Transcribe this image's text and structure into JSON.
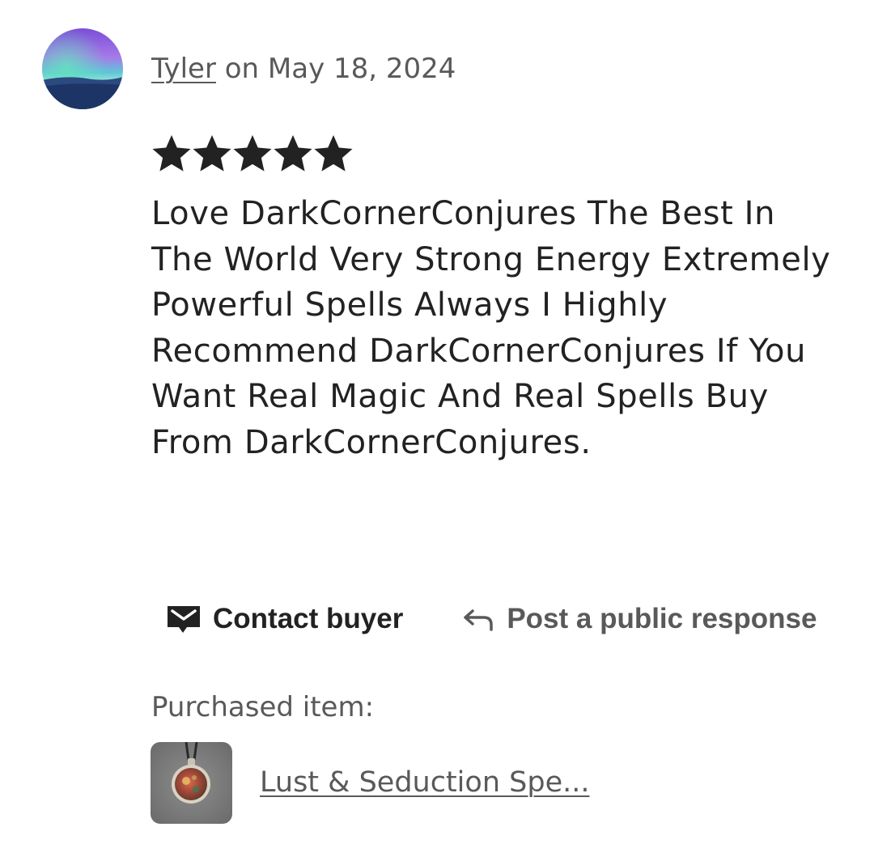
{
  "review": {
    "reviewer_name": "Tyler",
    "date_text": " on May 18, 2024",
    "rating": 5,
    "rating_max": 5,
    "text": "Love DarkCornerConjures The Best In The World Very Strong Energy Extremely Powerful Spells Always I Highly Recommend DarkCornerConjures If You Want Real Magic And Real Spells Buy From DarkCornerConjures."
  },
  "actions": {
    "contact_label": "Contact buyer",
    "contact_icon": "mail-icon",
    "respond_label": "Post a public response",
    "respond_icon": "reply-arrow-icon"
  },
  "purchase": {
    "label": "Purchased item:",
    "item_name": "Lust & Seduction Spe..."
  },
  "colors": {
    "text_primary": "#222222",
    "text_secondary": "#595959",
    "star": "#222222",
    "background": "#ffffff"
  }
}
